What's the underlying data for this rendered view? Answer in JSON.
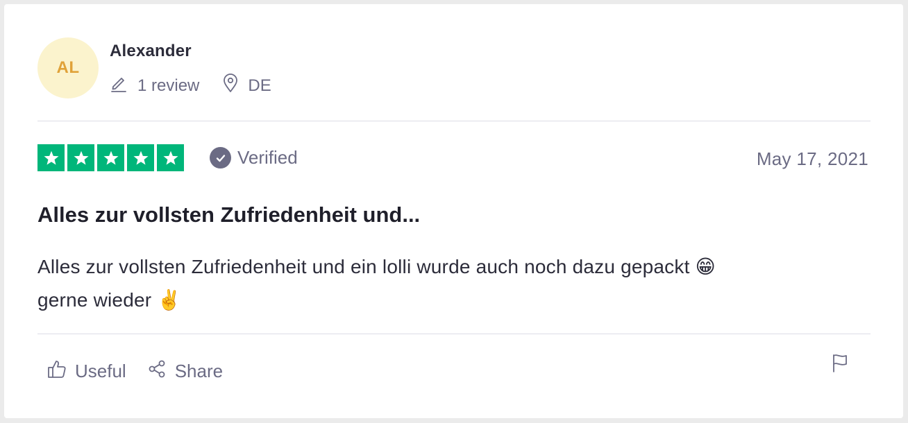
{
  "reviewer": {
    "initials": "AL",
    "name": "Alexander",
    "review_count": "1 review",
    "country": "DE"
  },
  "rating": {
    "stars": 5,
    "max_stars": 5,
    "verified_label": "Verified",
    "date": "May 17, 2021"
  },
  "review": {
    "title": "Alles zur vollsten Zufriedenheit und...",
    "body_line1": "Alles zur vollsten Zufriedenheit und ein lolli wurde auch noch dazu gepackt 😁",
    "body_line2": "gerne wieder ✌️"
  },
  "actions": {
    "useful_label": "Useful",
    "share_label": "Share"
  },
  "colors": {
    "star_green": "#00b67a",
    "avatar_bg": "#fbf3cd",
    "avatar_text": "#e0a239",
    "muted_text": "#6b6b84"
  }
}
